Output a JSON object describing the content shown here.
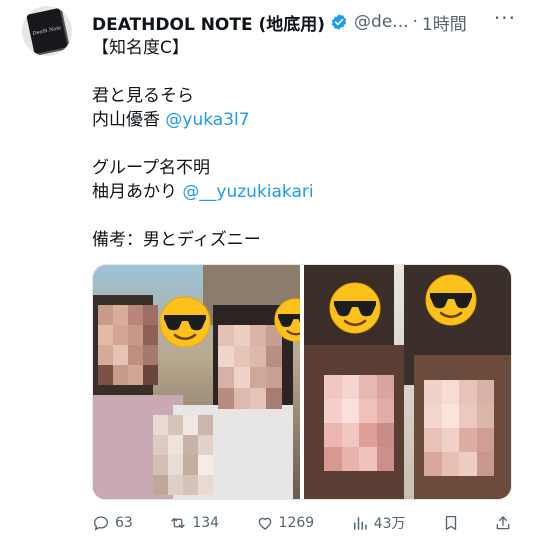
{
  "tweet": {
    "author_name": "DEATHDOL NOTE (地底用)",
    "handle": "@de...",
    "separator": "·",
    "time": "1時間",
    "more_label": "···",
    "avatar_text": "Death Note",
    "lines": [
      "【知名度C】",
      "",
      "君と見るそら",
      "内山優香",
      "",
      "グループ名不明",
      "柚月あかり",
      "",
      "備考：男とディズニー"
    ],
    "mention_1": "@yuka3l7",
    "mention_2": "@__yuzukiakari"
  },
  "actions": {
    "replies": "63",
    "reposts": "134",
    "likes": "1269",
    "views": "43万"
  },
  "icons": [
    "verified-badge-icon",
    "reply-icon",
    "repost-icon",
    "like-icon",
    "views-icon",
    "bookmark-icon",
    "share-icon",
    "sunglasses-emoji-icon"
  ],
  "colors": {
    "link": "#1d9bf0",
    "secondary": "#536471",
    "text": "#0f1419"
  }
}
